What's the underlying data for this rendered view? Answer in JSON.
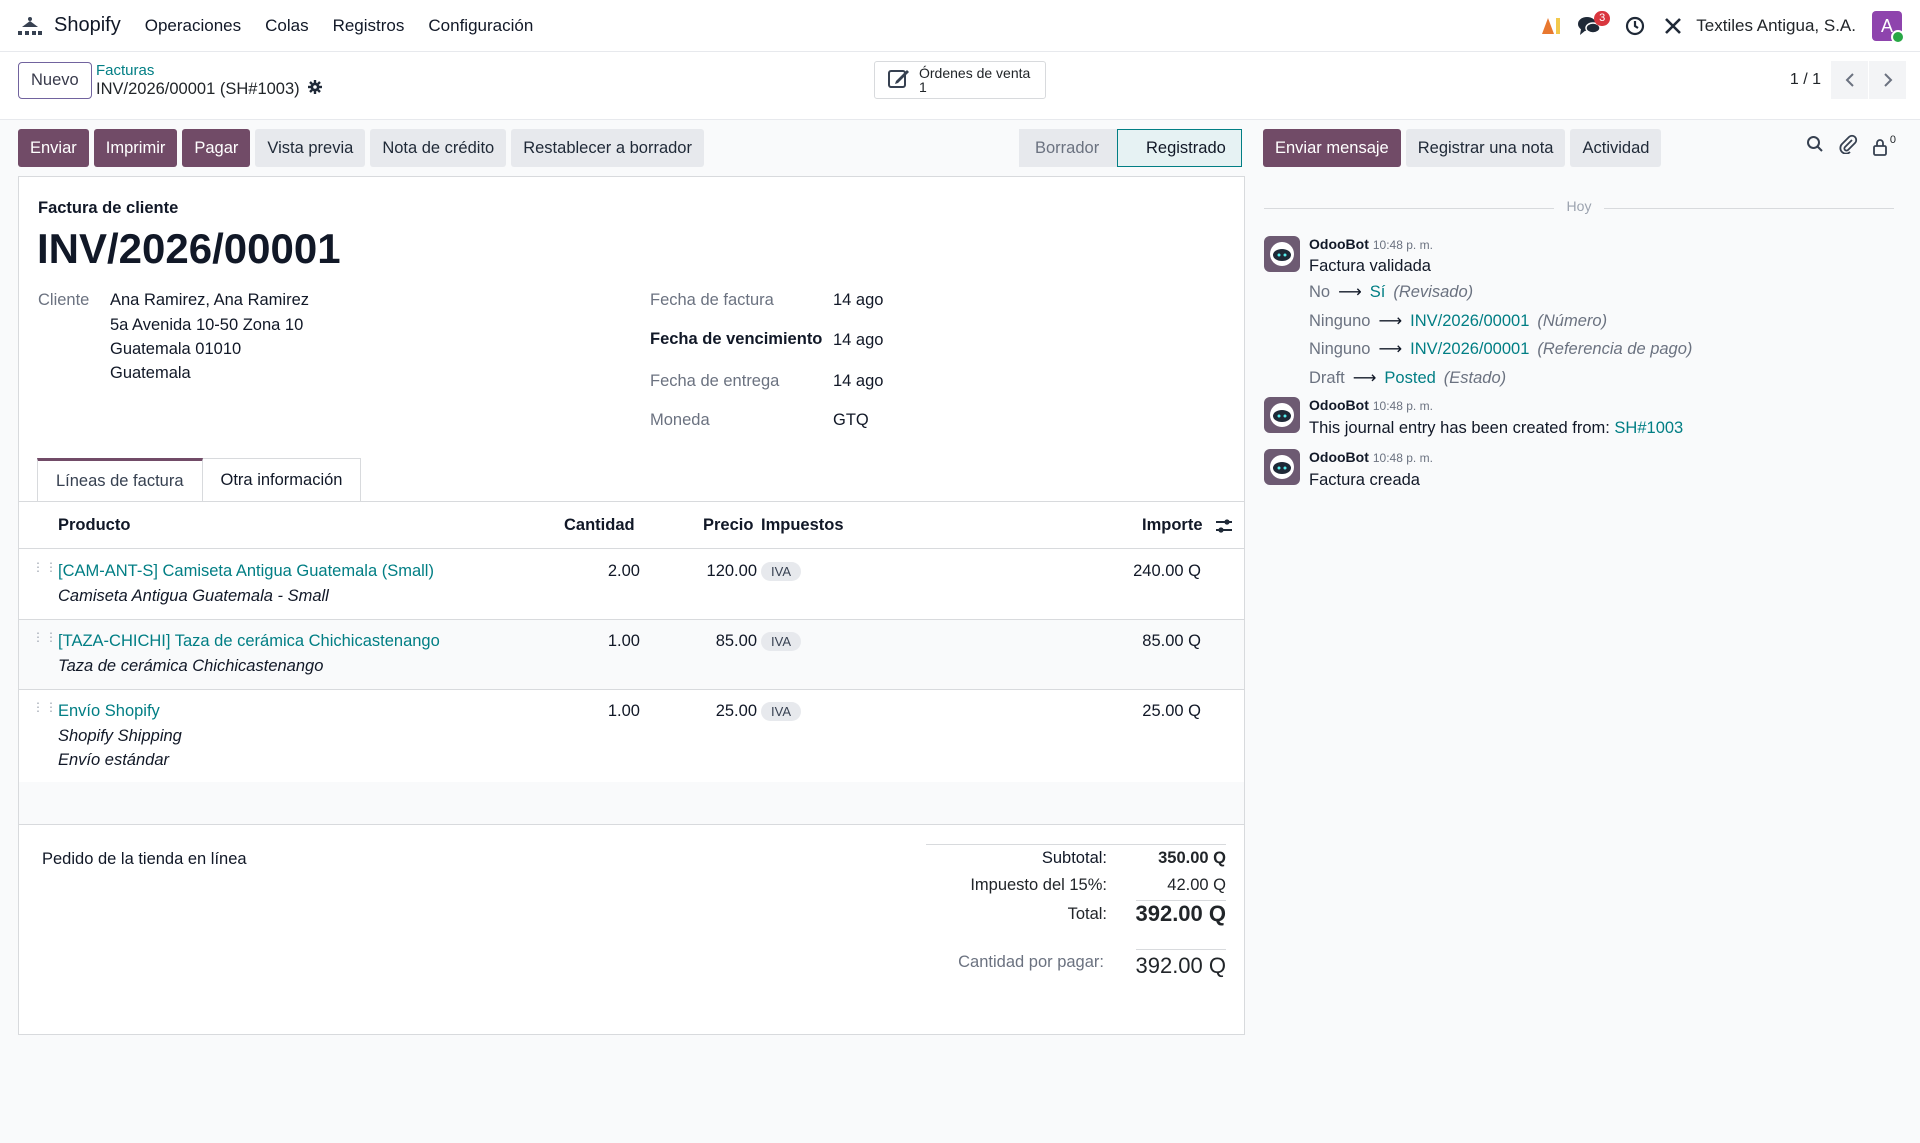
{
  "navbar": {
    "app_name": "Shopify",
    "menu": [
      "Operaciones",
      "Colas",
      "Registros",
      "Configuración"
    ],
    "messages_count": "3",
    "company": "Textiles Antigua, S.A.",
    "avatar_letter": "A"
  },
  "control": {
    "new_label": "Nuevo",
    "breadcrumb_parent": "Facturas",
    "breadcrumb_current": "INV/2026/00001 (SH#1003)",
    "smart_button": {
      "label": "Órdenes de venta",
      "count": "1"
    },
    "pager": "1 / 1"
  },
  "actions": {
    "send": "Enviar",
    "print": "Imprimir",
    "pay": "Pagar",
    "preview": "Vista previa",
    "credit_note": "Nota de crédito",
    "reset_draft": "Restablecer a borrador"
  },
  "status": {
    "draft": "Borrador",
    "posted": "Registrado"
  },
  "invoice": {
    "subtitle": "Factura de cliente",
    "number": "INV/2026/00001",
    "customer_label": "Cliente",
    "customer_name": "Ana Ramirez, Ana Ramirez",
    "address_line1": "5a Avenida 10-50 Zona 10",
    "address_line2": "Guatemala 01010",
    "address_line3": "Guatemala",
    "invoice_date_label": "Fecha de factura",
    "invoice_date": "14 ago",
    "due_date_label": "Fecha de vencimiento",
    "due_date": "14 ago",
    "delivery_date_label": "Fecha de entrega",
    "delivery_date": "14 ago",
    "currency_label": "Moneda",
    "currency": "GTQ"
  },
  "tabs": {
    "lines": "Líneas de factura",
    "other": "Otra información"
  },
  "table": {
    "headers": {
      "product": "Producto",
      "qty": "Cantidad",
      "price": "Precio",
      "taxes": "Impuestos",
      "amount": "Importe"
    },
    "rows": [
      {
        "product": "[CAM-ANT-S] Camiseta Antigua Guatemala (Small)",
        "desc1": "Camiseta Antigua Guatemala - Small",
        "desc2": "",
        "qty": "2.00",
        "price": "120.00",
        "tax": "IVA",
        "amount": "240.00 Q"
      },
      {
        "product": "[TAZA-CHICHI] Taza de cerámica Chichicastenango",
        "desc1": "Taza de cerámica Chichicastenango",
        "desc2": "",
        "qty": "1.00",
        "price": "85.00",
        "tax": "IVA",
        "amount": "85.00 Q"
      },
      {
        "product": "Envío Shopify",
        "desc1": "Shopify Shipping",
        "desc2": "Envío estándar",
        "qty": "1.00",
        "price": "25.00",
        "tax": "IVA",
        "amount": "25.00 Q"
      }
    ]
  },
  "footer": {
    "narration": "Pedido de la tienda en línea",
    "subtotal_label": "Subtotal:",
    "subtotal": "350.00 Q",
    "tax_label": "Impuesto del 15%:",
    "tax": "42.00 Q",
    "total_label": "Total:",
    "total": "392.00 Q",
    "due_label": "Cantidad por pagar:",
    "due": "392.00 Q"
  },
  "chatter": {
    "send_message": "Enviar mensaje",
    "log_note": "Registrar una nota",
    "activity": "Actividad",
    "followers": "0",
    "today": "Hoy",
    "messages": [
      {
        "author": "OdooBot",
        "time": "10:48 p. m.",
        "body": "Factura validada",
        "tracking": [
          {
            "old": "No",
            "new": "Sí",
            "field": "(Revisado)"
          },
          {
            "old": "Ninguno",
            "new": "INV/2026/00001",
            "field": "(Número)"
          },
          {
            "old": "Ninguno",
            "new": "INV/2026/00001",
            "field": "(Referencia de pago)"
          },
          {
            "old": "Draft",
            "new": "Posted",
            "field": "(Estado)"
          }
        ]
      },
      {
        "author": "OdooBot",
        "time": "10:48 p. m.",
        "body": "This journal entry has been created from:",
        "link": "SH#1003"
      },
      {
        "author": "OdooBot",
        "time": "10:48 p. m.",
        "body": "Factura creada"
      }
    ]
  }
}
